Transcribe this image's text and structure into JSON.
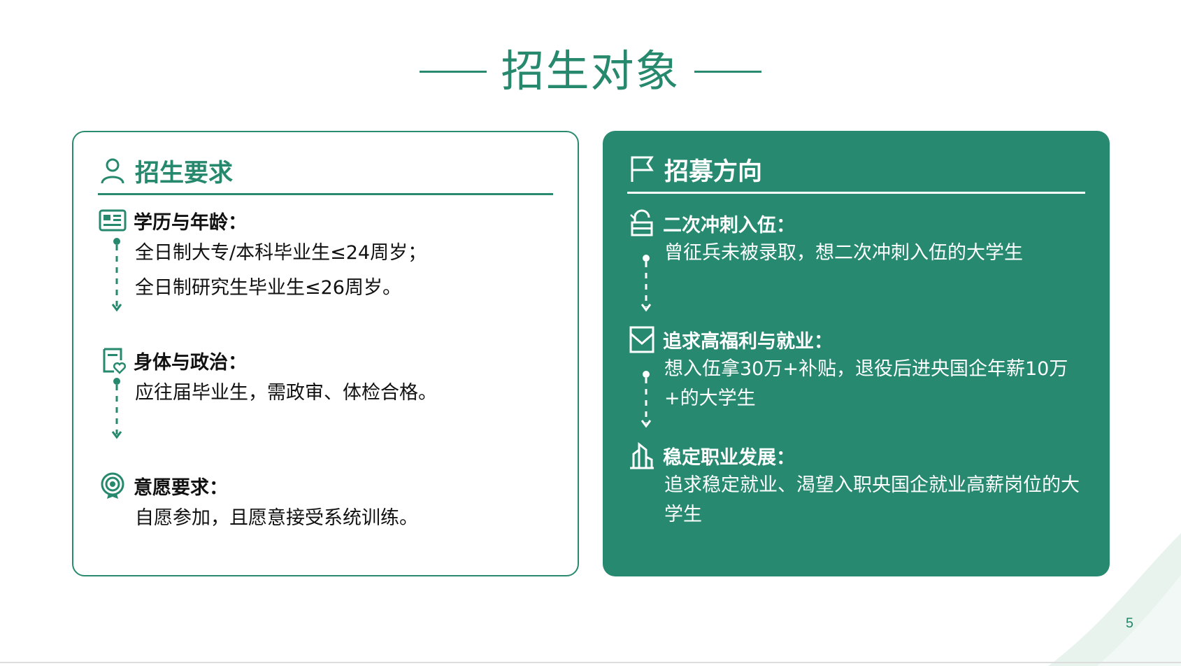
{
  "title": "招生对象",
  "page_number": "5",
  "left_card": {
    "title": "招生要求",
    "sections": [
      {
        "title": "学历与年龄：",
        "lines": [
          "全日制大专/本科毕业生≤24周岁；",
          "全日制研究生毕业生≤26周岁。"
        ]
      },
      {
        "title": "身体与政治：",
        "lines": [
          "应往届毕业生，需政审、体检合格。"
        ]
      },
      {
        "title": "意愿要求：",
        "lines": [
          "自愿参加，且愿意接受系统训练。"
        ]
      }
    ]
  },
  "right_card": {
    "title": "招募方向",
    "sections": [
      {
        "title": "二次冲刺入伍：",
        "lines": [
          "曾征兵未被录取，想二次冲刺入伍的大学生"
        ]
      },
      {
        "title": "追求高福利与就业：",
        "lines": [
          "想入伍拿30万+补贴，退役后进央国企年薪10万+的大学生"
        ]
      },
      {
        "title": "稳定职业发展：",
        "lines": [
          "追求稳定就业、渴望入职央国企就业高薪岗位的大学生"
        ]
      }
    ]
  },
  "colors": {
    "accent": "#268970",
    "text": "#111111",
    "card_text": "#ffffff"
  }
}
